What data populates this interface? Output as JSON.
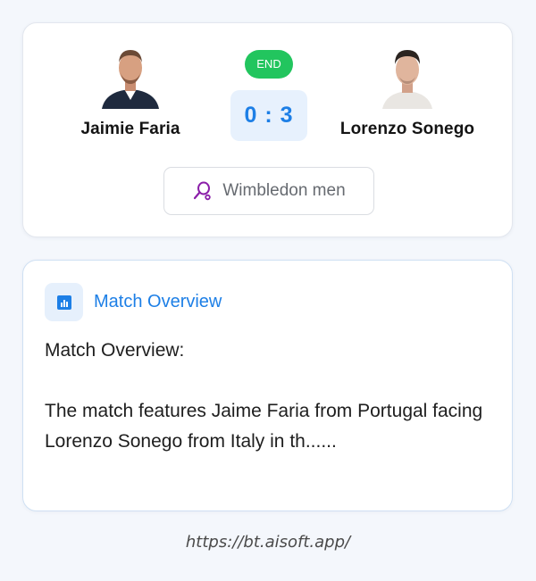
{
  "match": {
    "status": "END",
    "score": "0 : 3",
    "home_player": {
      "name": "Jaimie Faria"
    },
    "away_player": {
      "name": "Lorenzo Sonego"
    },
    "tournament": "Wimbledon men"
  },
  "overview": {
    "title": "Match Overview",
    "heading": "Match Overview:",
    "text": "The match features Jaime Faria from Portugal facing Lorenzo Sonego from Italy in th......"
  },
  "footer": {
    "url": "https://bt.aisoft.app/"
  },
  "colors": {
    "accent": "#1d7fe6",
    "status_green": "#22c55e",
    "tournament_icon": "#8b1fa9"
  },
  "icons": {
    "tournament": "tennis-racket-icon",
    "overview": "bar-chart-icon"
  }
}
